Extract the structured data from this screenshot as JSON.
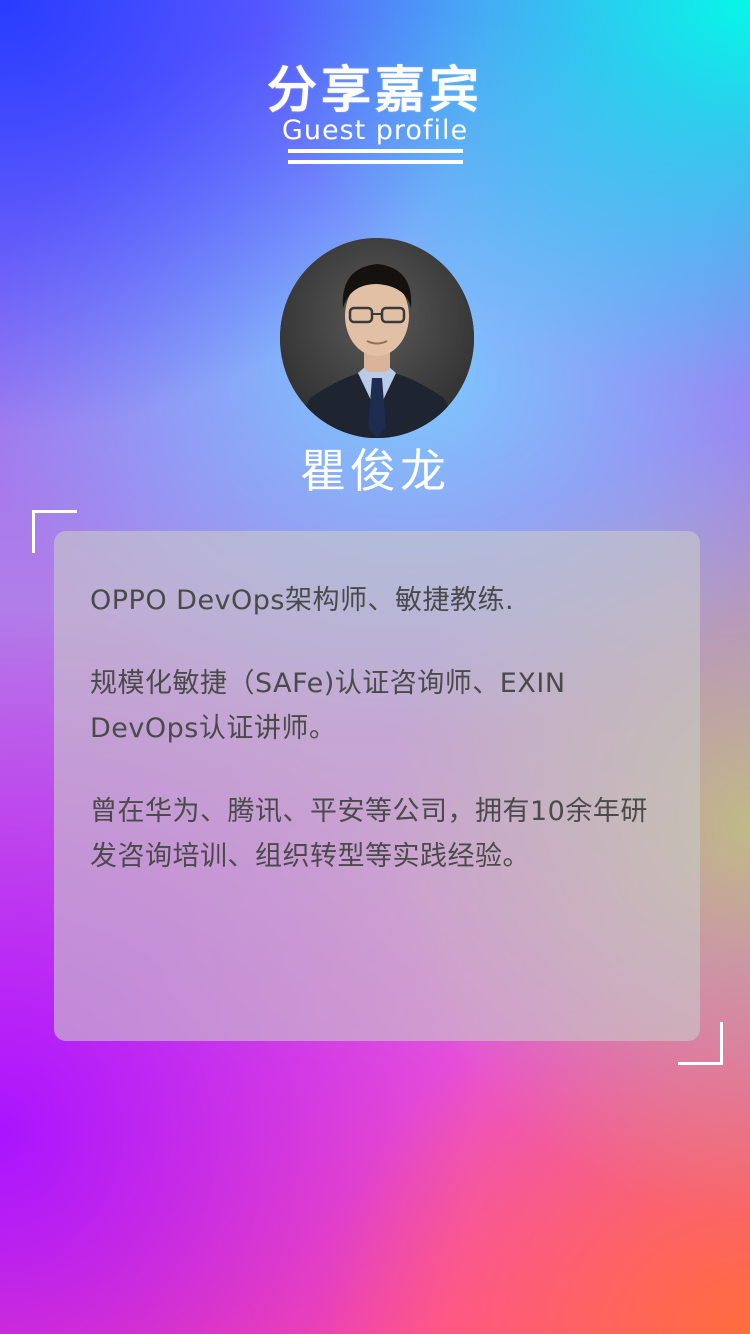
{
  "header": {
    "title": "分享嘉宾",
    "subtitle": "Guest profile"
  },
  "guest": {
    "name": "瞿俊龙",
    "bio": [
      "OPPO DevOps架构师、敏捷教练.",
      "规模化敏捷（SAFe)认证咨询师、EXIN DevOps认证讲师。",
      "曾在华为、腾讯、平安等公司，拥有10余年研发咨询培训、组织转型等实践经验。"
    ]
  },
  "colors": {
    "text_on_gradient": "#ffffff",
    "card_text": "#4a4a4a"
  }
}
